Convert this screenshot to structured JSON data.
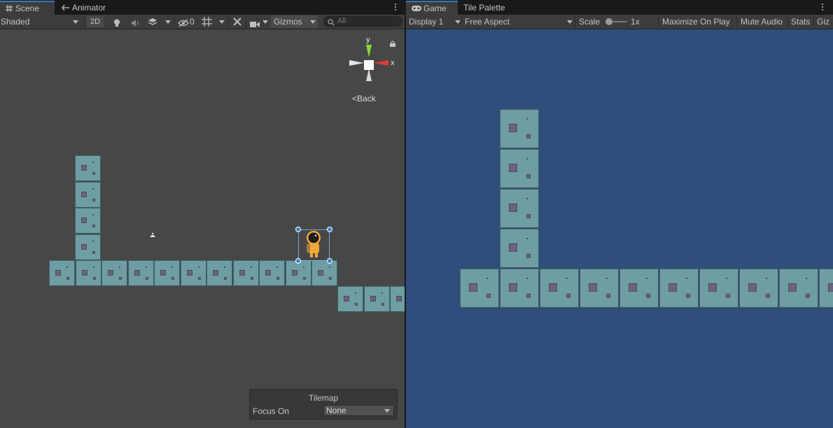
{
  "scene_panel": {
    "tabs": [
      {
        "icon": "grid-icon",
        "label": "Scene"
      },
      {
        "icon": "animator-icon",
        "label": "Animator"
      }
    ],
    "toolbar": {
      "shading_mode": "Shaded",
      "mode_2d": "2D",
      "hidden_count": "0",
      "gizmos": "Gizmos",
      "search_placeholder": "All"
    },
    "orientation_gizmo": {
      "y_axis": "y",
      "x_axis": "x",
      "back_label": "Back",
      "back_glyph": "<"
    },
    "tilemap_overlay": {
      "title": "Tilemap",
      "focus_label": "Focus On",
      "focus_value": "None"
    }
  },
  "game_panel": {
    "tabs": [
      {
        "icon": "gamepad-icon",
        "label": "Game"
      },
      {
        "label": "Tile Palette"
      }
    ],
    "toolbar": {
      "display": "Display 1",
      "aspect": "Free Aspect",
      "scale_label": "Scale",
      "scale_value": "1x",
      "maximize": "Maximize On Play",
      "mute": "Mute Audio",
      "stats": "Stats",
      "gizmos": "Giz"
    }
  },
  "colors": {
    "scene_background": "#474747",
    "game_background": "#304e7c",
    "tile_fill": "#6e9ea2",
    "tile_block": "#6b6380",
    "selection_handle": "#3b86d8",
    "x_axis": "#e03c31",
    "y_axis": "#8cd936",
    "active_tab_accent": "#3a79bb"
  }
}
